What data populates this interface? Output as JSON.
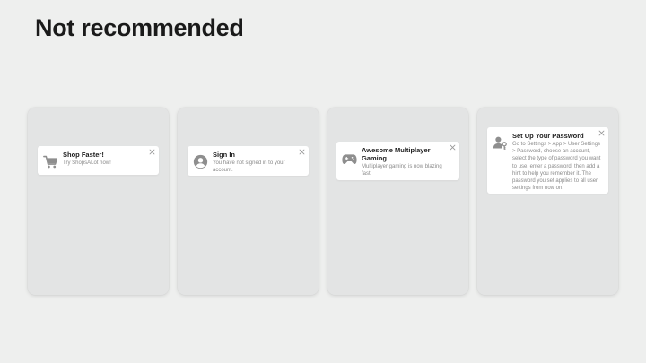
{
  "page": {
    "title": "Not recommended"
  },
  "banners": [
    {
      "title": "Shop Faster!",
      "body": "Try ShopsALot now!",
      "icon": "cart-icon"
    },
    {
      "title": "Sign In",
      "body": "You have not signed in to your account.",
      "icon": "person-circle-icon"
    },
    {
      "title": "Awesome Multiplayer Gaming",
      "body": "Multiplayer gaming is now blazing fast.",
      "icon": "gamecontroller-icon"
    },
    {
      "title": "Set Up Your Password",
      "body": "Go to Settings > App > User Settings > Password, choose an account, select the type of password you want to use, enter a password, then add a hint to help you remember it. The password you set applies to all user settings from now on.",
      "icon": "person-key-icon"
    }
  ],
  "colors": {
    "background": "#eeefee",
    "card": "#e3e4e4",
    "banner": "#ffffff",
    "icon": "#8e8e8e",
    "title_text": "#1d1d1d",
    "body_text": "#8a8a8a"
  }
}
